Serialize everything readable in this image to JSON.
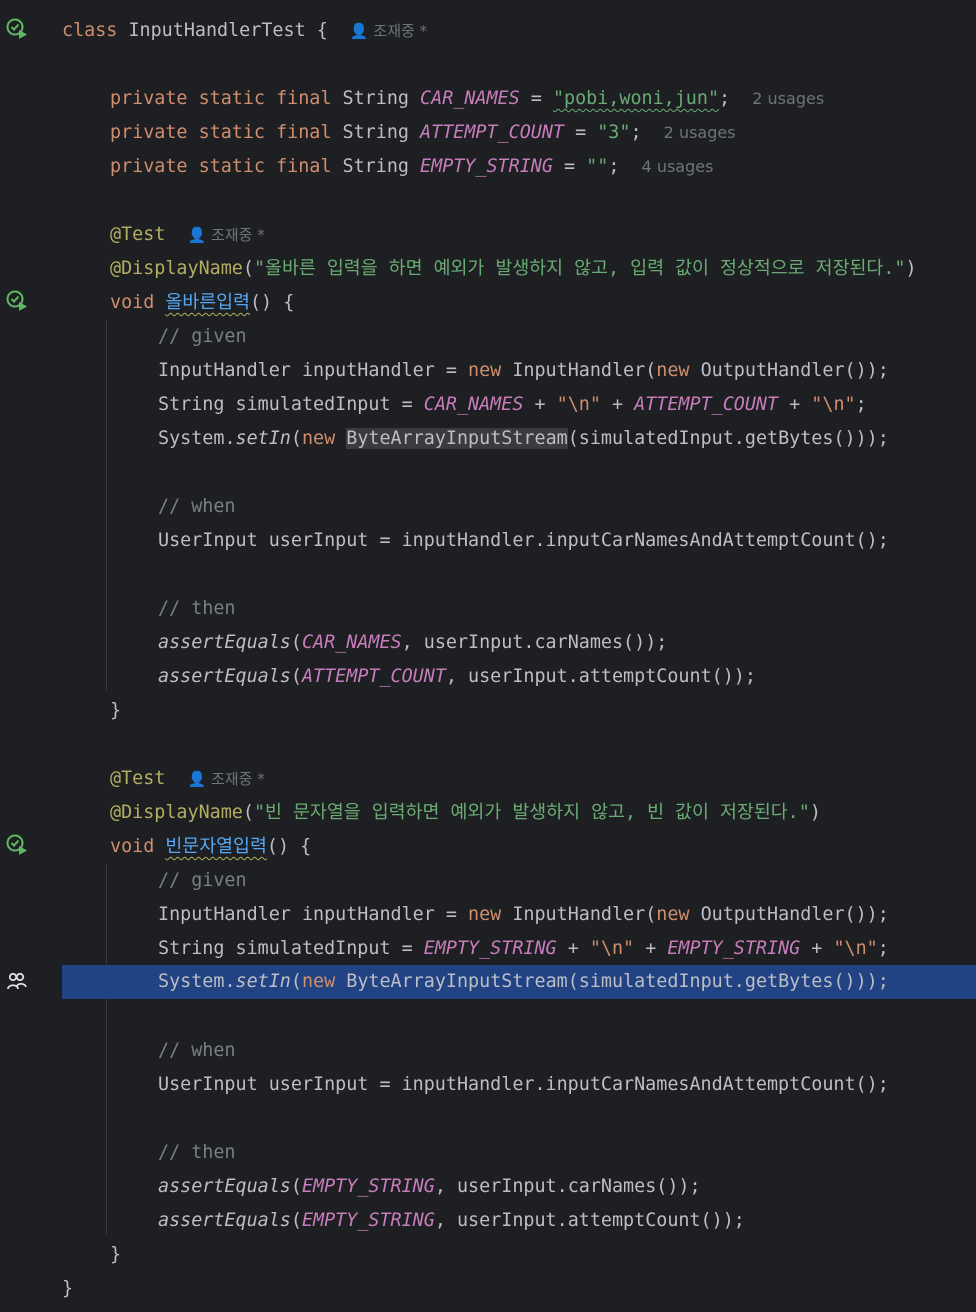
{
  "class_decl": {
    "keyword": "class",
    "name": "InputHandlerTest",
    "brace": "{",
    "author": "조재중 *"
  },
  "fields": [
    {
      "modifiers": "private static final",
      "type": "String",
      "name": "CAR_NAMES",
      "eq": "=",
      "value": "\"pobi,woni,jun\"",
      "semi": ";",
      "usages": "2 usages"
    },
    {
      "modifiers": "private static final",
      "type": "String",
      "name": "ATTEMPT_COUNT",
      "eq": "=",
      "value": "\"3\"",
      "semi": ";",
      "usages": "2 usages"
    },
    {
      "modifiers": "private static final",
      "type": "String",
      "name": "EMPTY_STRING",
      "eq": "=",
      "value": "\"\"",
      "semi": ";",
      "usages": "4 usages"
    }
  ],
  "annotations": {
    "test": "@Test",
    "display_name": "@DisplayName"
  },
  "symbols": {
    "void": "void",
    "new": "new",
    "open_brace": "() {",
    "close_brace": "}",
    "input_handler": "InputHandler",
    "output_handler": "OutputHandler",
    "string": "String",
    "system": "System",
    "set_in": "setIn",
    "byte_stream": "ByteArrayInputStream",
    "user_input_type": "UserInput",
    "assert_equals": "assertEquals",
    "newline_quote": "\"\\n\""
  },
  "methods": [
    {
      "author": "조재중 *",
      "display": "\"올바른 입력을 하면 예외가 발생하지 않고, 입력 값이 정상적으로 저장된다.\"",
      "name": "올바른입력",
      "c_given": "// given",
      "c_when": "// when",
      "c_then": "// then",
      "const_a": "CAR_NAMES",
      "const_b": "ATTEMPT_COUNT",
      "assert1_const": "CAR_NAMES",
      "assert2_const": "ATTEMPT_COUNT"
    },
    {
      "author": "조재중 *",
      "display": "\"빈 문자열을 입력하면 예외가 발생하지 않고, 빈 값이 저장된다.\"",
      "name": "빈문자열입력",
      "c_given": "// given",
      "c_when": "// when",
      "c_then": "// then",
      "const_a": "EMPTY_STRING",
      "const_b": "EMPTY_STRING",
      "assert1_const": "EMPTY_STRING",
      "assert2_const": "EMPTY_STRING"
    }
  ],
  "code_text": {
    "handler_decl": " inputHandler = ",
    "sim_decl": " simulatedInput = ",
    "plus": " + ",
    "get_bytes": "(simulatedInput.getBytes()));",
    "user_input_decl": " userInput = inputHandler.inputCarNamesAndAttemptCount();",
    "car_names_call": ", userInput.carNames());",
    "attempt_call": ", userInput.attemptCount());",
    "paren_open": "(",
    "paren_close": "());",
    "dot": ".",
    "semi": ";"
  },
  "colors": {
    "background": "#1e1f22",
    "keyword": "#cf8e6d",
    "string": "#6aab73",
    "constant": "#c77dbb",
    "annotation": "#b3ae60",
    "method": "#56a8f5",
    "comment": "#7a7e85",
    "selection": "#214283"
  },
  "gutter_icons": [
    "run-test-icon",
    "run-test-icon",
    "run-test-icon",
    "debug-icon"
  ]
}
